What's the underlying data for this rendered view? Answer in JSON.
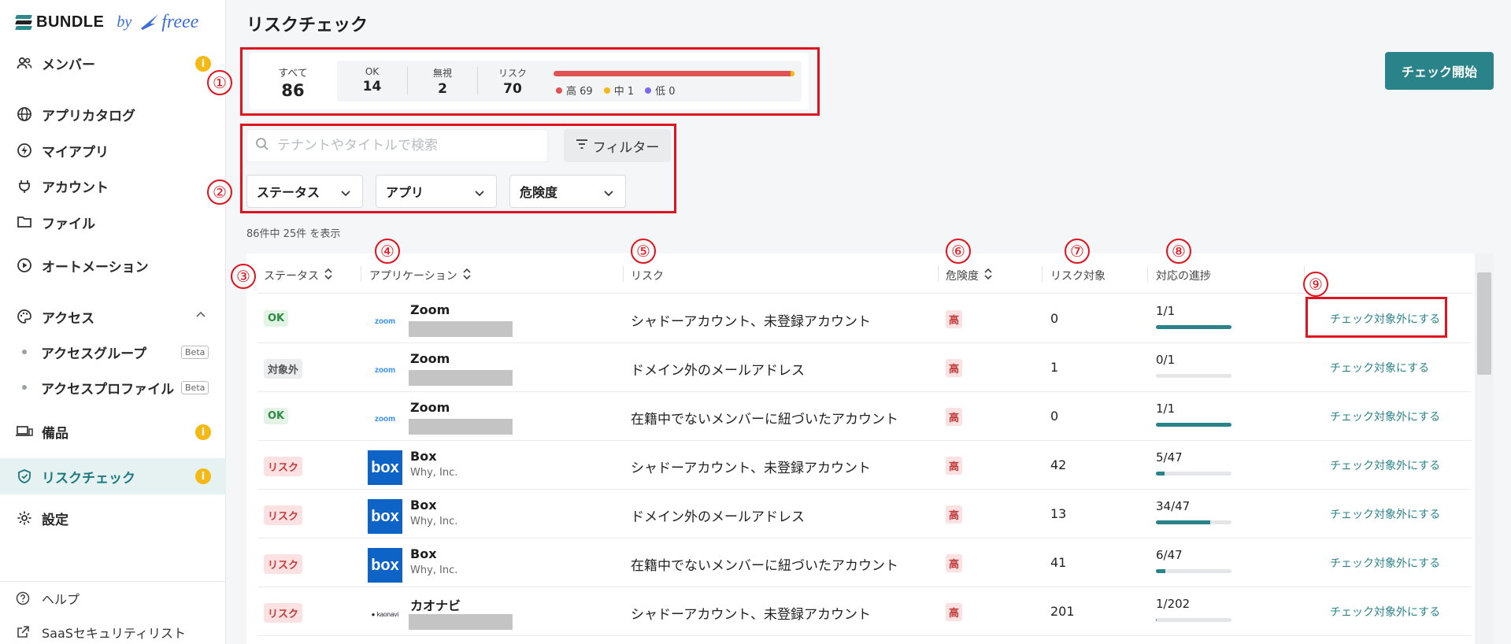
{
  "brand": {
    "name": "BUNDLE",
    "by": "by",
    "partner": "freee"
  },
  "sidebar": {
    "items": [
      {
        "key": "members",
        "label": "メンバー",
        "icon": "people-icon",
        "warning": true
      },
      {
        "key": "app-catalog",
        "label": "アプリカタログ",
        "icon": "globe-icon"
      },
      {
        "key": "my-apps",
        "label": "マイアプリ",
        "icon": "bolt-icon"
      },
      {
        "key": "accounts",
        "label": "アカウント",
        "icon": "plug-icon"
      },
      {
        "key": "files",
        "label": "ファイル",
        "icon": "folder-icon"
      },
      {
        "key": "automation",
        "label": "オートメーション",
        "icon": "play-circle-icon"
      },
      {
        "key": "access",
        "label": "アクセス",
        "icon": "palette-icon"
      },
      {
        "key": "equipment",
        "label": "備品",
        "icon": "devices-icon",
        "warning": true
      },
      {
        "key": "risk-check",
        "label": "リスクチェック",
        "icon": "shield-check-icon",
        "warning": true,
        "active": true
      },
      {
        "key": "settings",
        "label": "設定",
        "icon": "gear-icon"
      }
    ],
    "access_sub": [
      {
        "label": "アクセスグループ",
        "badge": "Beta"
      },
      {
        "label": "アクセスプロファイル",
        "badge": "Beta"
      }
    ],
    "footer": [
      {
        "label": "ヘルプ",
        "icon": "help-circle-icon"
      },
      {
        "label": "SaaSセキュリティリスト",
        "icon": "external-link-icon"
      }
    ],
    "warning_glyph": "i"
  },
  "page": {
    "title": "リスクチェック",
    "start_button": "チェック開始"
  },
  "summary": {
    "all": {
      "label": "すべて",
      "value": "86"
    },
    "ok": {
      "label": "OK",
      "value": "14"
    },
    "ignored": {
      "label": "無視",
      "value": "2"
    },
    "risk": {
      "label": "リスク",
      "value": "70"
    },
    "legend": [
      {
        "label": "高 69",
        "color": "#e05353"
      },
      {
        "label": "中 1",
        "color": "#f5b915"
      },
      {
        "label": "低 0",
        "color": "#7b68ee"
      }
    ]
  },
  "search": {
    "placeholder": "テナントやタイトルで検索",
    "filter_label": "フィルター"
  },
  "filters": [
    "ステータス",
    "アプリ",
    "危険度"
  ],
  "result_count": "86件中 25件 を表示",
  "table": {
    "headers": [
      "ステータス",
      "アプリケーション",
      "リスク",
      "危険度",
      "リスク対象",
      "対応の進捗"
    ],
    "rows": [
      {
        "status": "OK",
        "status_type": "ok",
        "app": "Zoom",
        "logo": "zoom",
        "tenant": "",
        "risk": "シャドーアカウント、未登録アカウント",
        "severity": "高",
        "target": "0",
        "progress": "1/1",
        "progress_ratio": 1.0,
        "action": "チェック対象外にする"
      },
      {
        "status": "対象外",
        "status_type": "ex",
        "app": "Zoom",
        "logo": "zoom",
        "tenant": "",
        "risk": "ドメイン外のメールアドレス",
        "severity": "高",
        "target": "1",
        "progress": "0/1",
        "progress_ratio": 0.0,
        "action": "チェック対象にする"
      },
      {
        "status": "OK",
        "status_type": "ok",
        "app": "Zoom",
        "logo": "zoom",
        "tenant": "",
        "risk": "在籍中でないメンバーに紐づいたアカウント",
        "severity": "高",
        "target": "0",
        "progress": "1/1",
        "progress_ratio": 1.0,
        "action": "チェック対象外にする"
      },
      {
        "status": "リスク",
        "status_type": "risk",
        "app": "Box",
        "logo": "box",
        "tenant": "Why, Inc.",
        "risk": "シャドーアカウント、未登録アカウント",
        "severity": "高",
        "target": "42",
        "progress": "5/47",
        "progress_ratio": 0.106,
        "action": "チェック対象外にする"
      },
      {
        "status": "リスク",
        "status_type": "risk",
        "app": "Box",
        "logo": "box",
        "tenant": "Why, Inc.",
        "risk": "ドメイン外のメールアドレス",
        "severity": "高",
        "target": "13",
        "progress": "34/47",
        "progress_ratio": 0.723,
        "action": "チェック対象外にする"
      },
      {
        "status": "リスク",
        "status_type": "risk",
        "app": "Box",
        "logo": "box",
        "tenant": "Why, Inc.",
        "risk": "在籍中でないメンバーに紐づいたアカウント",
        "severity": "高",
        "target": "41",
        "progress": "6/47",
        "progress_ratio": 0.128,
        "action": "チェック対象外にする"
      },
      {
        "status": "リスク",
        "status_type": "risk",
        "app": "カオナビ",
        "logo": "kaonavi",
        "tenant": "",
        "risk": "シャドーアカウント、未登録アカウント",
        "severity": "高",
        "target": "201",
        "progress": "1/202",
        "progress_ratio": 0.005,
        "action": "チェック対象外にする"
      }
    ]
  },
  "logos": {
    "zoom": "zoom",
    "box": "box",
    "kaonavi": "● kaonavi"
  },
  "annotations": [
    "①",
    "②",
    "③",
    "④",
    "⑤",
    "⑥",
    "⑦",
    "⑧",
    "⑨"
  ]
}
